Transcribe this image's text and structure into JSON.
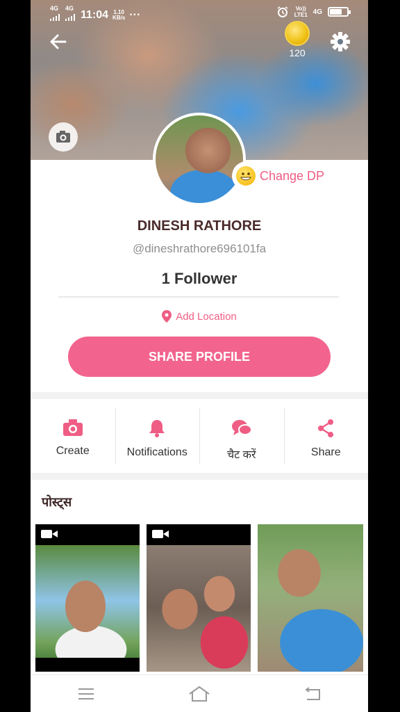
{
  "status_bar": {
    "network_left": "4G",
    "network_right": "4G",
    "time": "11:04",
    "speed_value": "1.10",
    "speed_unit": "KB/s",
    "more": "···",
    "volte": "Vo))",
    "lte": "LTE1",
    "network_4g": "4G",
    "battery_level": 0.7
  },
  "header": {
    "coins": "120"
  },
  "profile": {
    "change_dp_label": "Change DP",
    "name": "DINESH RATHORE",
    "handle": "@dineshrathore696101fa",
    "followers": "1 Follower",
    "add_location": "Add Location",
    "share_label": "SHARE PROFILE"
  },
  "actions": [
    {
      "label": "Create",
      "icon": "camera-icon"
    },
    {
      "label": "Notifications",
      "icon": "bell-icon"
    },
    {
      "label": "चैट करें",
      "icon": "chat-icon"
    },
    {
      "label": "Share",
      "icon": "share-icon"
    }
  ],
  "posts": {
    "title": "पोस्ट्स",
    "items": [
      {
        "type": "video"
      },
      {
        "type": "video"
      },
      {
        "type": "image"
      }
    ]
  },
  "colors": {
    "accent": "#f2648d",
    "accent_text": "#ef5d84"
  }
}
